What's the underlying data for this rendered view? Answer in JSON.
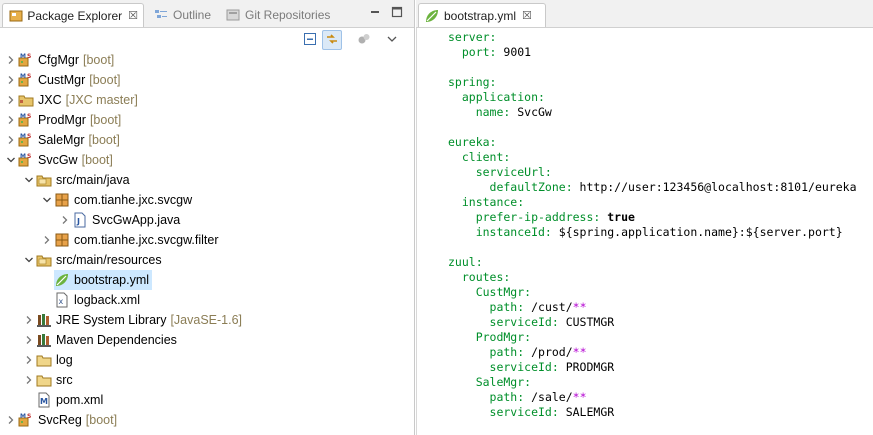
{
  "left_view": {
    "tabs": [
      {
        "label": "Package Explorer",
        "active": true,
        "close": "☒"
      },
      {
        "label": "Outline",
        "active": false
      },
      {
        "label": "Git Repositories",
        "active": false
      }
    ]
  },
  "tree": [
    {
      "label": "CfgMgr",
      "decoration": "[boot]",
      "indent": 0,
      "twisty": "›",
      "icon": "maven-project-icon"
    },
    {
      "label": "CustMgr",
      "decoration": "[boot]",
      "indent": 0,
      "twisty": "›",
      "icon": "maven-project-icon"
    },
    {
      "label": "JXC",
      "decoration": "[JXC master]",
      "indent": 0,
      "twisty": "›",
      "icon": "folder-project-icon"
    },
    {
      "label": "ProdMgr",
      "decoration": "[boot]",
      "indent": 0,
      "twisty": "›",
      "icon": "maven-project-icon"
    },
    {
      "label": "SaleMgr",
      "decoration": "[boot]",
      "indent": 0,
      "twisty": "›",
      "icon": "maven-project-icon"
    },
    {
      "label": "SvcGw",
      "decoration": "[boot]",
      "indent": 0,
      "twisty": "⌄",
      "icon": "maven-project-icon"
    },
    {
      "label": "src/main/java",
      "decoration": "",
      "indent": 1,
      "twisty": "⌄",
      "icon": "source-folder-icon"
    },
    {
      "label": "com.tianhe.jxc.svcgw",
      "decoration": "",
      "indent": 2,
      "twisty": "⌄",
      "icon": "package-icon"
    },
    {
      "label": "SvcGwApp.java",
      "decoration": "",
      "indent": 3,
      "twisty": "›",
      "icon": "java-file-icon"
    },
    {
      "label": "com.tianhe.jxc.svcgw.filter",
      "decoration": "",
      "indent": 2,
      "twisty": "›",
      "icon": "package-icon"
    },
    {
      "label": "src/main/resources",
      "decoration": "",
      "indent": 1,
      "twisty": "⌄",
      "icon": "source-folder-icon"
    },
    {
      "label": "bootstrap.yml",
      "decoration": "",
      "indent": 2,
      "twisty": "",
      "icon": "yaml-file-icon",
      "selected": true
    },
    {
      "label": "logback.xml",
      "decoration": "",
      "indent": 2,
      "twisty": "",
      "icon": "xml-file-icon"
    },
    {
      "label": "JRE System Library",
      "decoration": "[JavaSE-1.6]",
      "indent": 1,
      "twisty": "›",
      "icon": "library-icon"
    },
    {
      "label": "Maven Dependencies",
      "decoration": "",
      "indent": 1,
      "twisty": "›",
      "icon": "library-icon"
    },
    {
      "label": "log",
      "decoration": "",
      "indent": 1,
      "twisty": "›",
      "icon": "folder-icon"
    },
    {
      "label": "src",
      "decoration": "",
      "indent": 1,
      "twisty": "›",
      "icon": "folder-icon"
    },
    {
      "label": "pom.xml",
      "decoration": "",
      "indent": 1,
      "twisty": "",
      "icon": "maven-pom-icon"
    },
    {
      "label": "SvcReg",
      "decoration": "[boot]",
      "indent": 0,
      "twisty": "›",
      "icon": "maven-project-icon"
    }
  ],
  "editor": {
    "tab_label": "bootstrap.yml",
    "tab_close": "☒",
    "lines": [
      [
        {
          "t": "k",
          "s": "server:"
        }
      ],
      [
        {
          "t": "k",
          "s": "  port:"
        },
        {
          "t": "v",
          "s": " 9001"
        }
      ],
      [],
      [
        {
          "t": "k",
          "s": "spring:"
        }
      ],
      [
        {
          "t": "k",
          "s": "  application:"
        }
      ],
      [
        {
          "t": "k",
          "s": "    name:"
        },
        {
          "t": "v",
          "s": " SvcGw"
        }
      ],
      [],
      [
        {
          "t": "k",
          "s": "eureka:"
        }
      ],
      [
        {
          "t": "k",
          "s": "  client:"
        }
      ],
      [
        {
          "t": "k",
          "s": "    serviceUrl:"
        }
      ],
      [
        {
          "t": "k",
          "s": "      defaultZone:"
        },
        {
          "t": "v",
          "s": " http://user:123456@localhost:8101/eureka"
        }
      ],
      [
        {
          "t": "k",
          "s": "  instance:"
        }
      ],
      [
        {
          "t": "k",
          "s": "    prefer-ip-address:"
        },
        {
          "t": "kw",
          "s": " true"
        }
      ],
      [
        {
          "t": "k",
          "s": "    instanceId:"
        },
        {
          "t": "v",
          "s": " ${spring.application.name}:${server.port}"
        }
      ],
      [],
      [
        {
          "t": "k",
          "s": "zuul:"
        }
      ],
      [
        {
          "t": "k",
          "s": "  routes:"
        }
      ],
      [
        {
          "t": "k",
          "s": "    CustMgr:"
        }
      ],
      [
        {
          "t": "k",
          "s": "      path:"
        },
        {
          "t": "v",
          "s": " /cust/"
        },
        {
          "t": "g",
          "s": "**"
        }
      ],
      [
        {
          "t": "k",
          "s": "      serviceId:"
        },
        {
          "t": "v",
          "s": " CUSTMGR"
        }
      ],
      [
        {
          "t": "k",
          "s": "    ProdMgr:"
        }
      ],
      [
        {
          "t": "k",
          "s": "      path:"
        },
        {
          "t": "v",
          "s": " /prod/"
        },
        {
          "t": "g",
          "s": "**"
        }
      ],
      [
        {
          "t": "k",
          "s": "      serviceId:"
        },
        {
          "t": "v",
          "s": " PRODMGR"
        }
      ],
      [
        {
          "t": "k",
          "s": "    SaleMgr:"
        }
      ],
      [
        {
          "t": "k",
          "s": "      path:"
        },
        {
          "t": "v",
          "s": " /sale/"
        },
        {
          "t": "g",
          "s": "**"
        }
      ],
      [
        {
          "t": "k",
          "s": "      serviceId:"
        },
        {
          "t": "v",
          "s": " SALEMGR"
        }
      ]
    ]
  },
  "colors": {
    "yaml_key": "#008f2a",
    "glob": "#b300d1",
    "selection": "#cde8ff",
    "decoration": "#8b7d55"
  }
}
